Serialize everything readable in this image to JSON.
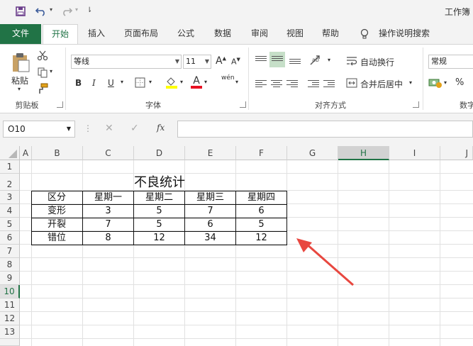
{
  "window": {
    "title": "工作簿"
  },
  "tabs": [
    "文件",
    "开始",
    "插入",
    "页面布局",
    "公式",
    "数据",
    "审阅",
    "视图",
    "帮助",
    "操作说明搜索"
  ],
  "ribbon": {
    "clipboard": {
      "paste": "粘贴",
      "group": "剪贴板"
    },
    "font": {
      "name": "等线",
      "size": "11",
      "grow": "A",
      "shrink": "A",
      "bold": "B",
      "italic": "I",
      "underline": "U",
      "font_color": "A",
      "wen": "wén",
      "group": "字体"
    },
    "alignment": {
      "wrap": "自动换行",
      "merge": "合并后居中",
      "group": "对齐方式"
    },
    "number": {
      "format": "常规",
      "percent": "%",
      "group": "数字"
    }
  },
  "formula_bar": {
    "name_box": "O10",
    "fx": "fx",
    "value": ""
  },
  "sheet": {
    "columns": [
      "A",
      "B",
      "C",
      "D",
      "E",
      "F",
      "G",
      "H",
      "I",
      "J"
    ],
    "selected_column": "H",
    "rows": [
      "1",
      "2",
      "3",
      "4",
      "5",
      "6",
      "7",
      "8",
      "9",
      "10",
      "11",
      "12",
      "13"
    ],
    "selected_row": "10",
    "table_title": "不良统计",
    "headers": [
      "区分",
      "星期一",
      "星期二",
      "星期三",
      "星期四"
    ],
    "data": [
      [
        "变形",
        "3",
        "5",
        "7",
        "6"
      ],
      [
        "开裂",
        "7",
        "5",
        "6",
        "5"
      ],
      [
        "错位",
        "8",
        "12",
        "34",
        "12"
      ]
    ]
  },
  "colors": {
    "accent": "#217346",
    "arrow": "#e8473f"
  }
}
